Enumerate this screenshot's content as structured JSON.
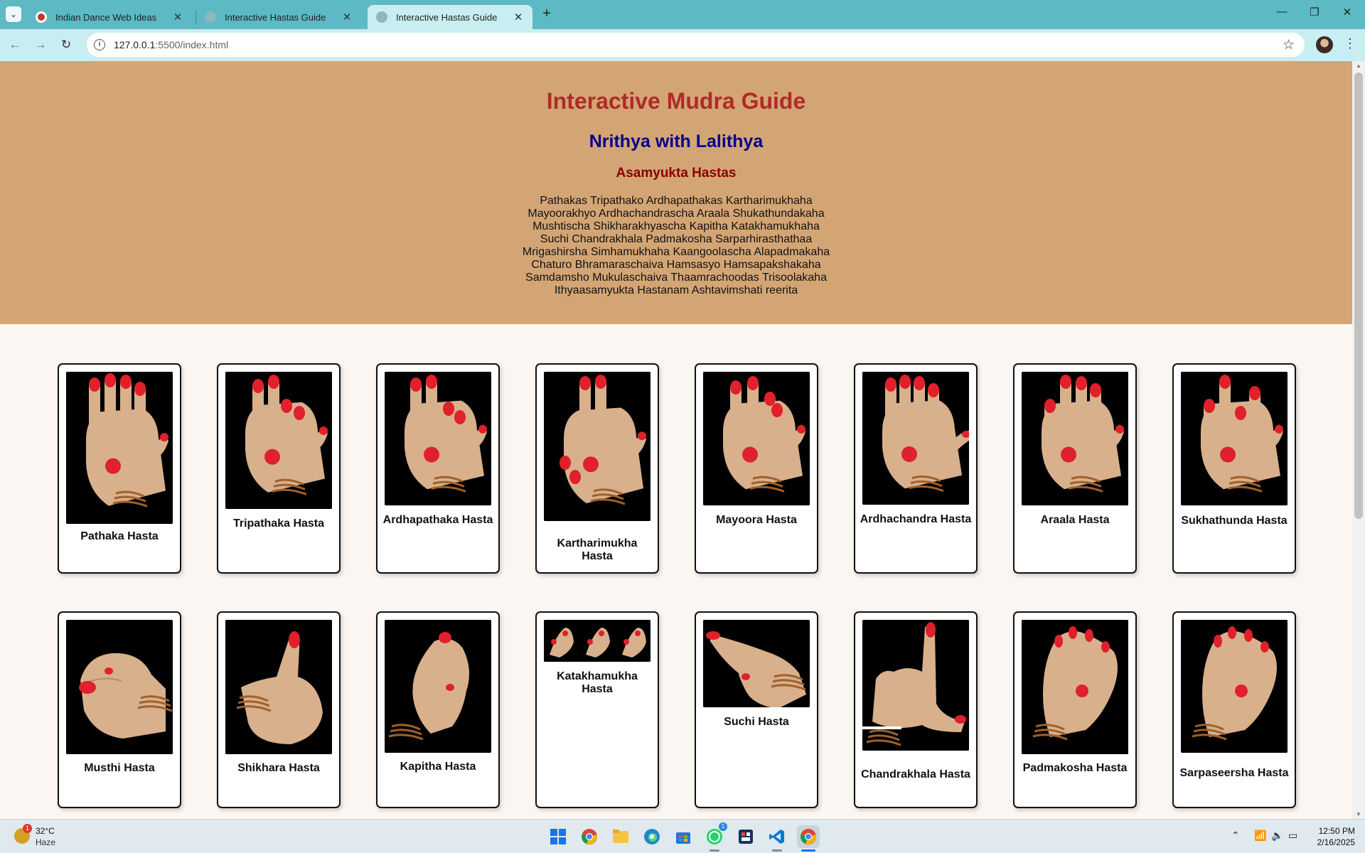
{
  "browser": {
    "tabs": [
      {
        "title": "Indian Dance Web Ideas",
        "favicon_color": "#c0392b",
        "active": false
      },
      {
        "title": "Interactive Hastas Guide",
        "favicon_color": "#8fb7bd",
        "active": false
      },
      {
        "title": "Interactive Hastas Guide",
        "favicon_color": "#8fb7bd",
        "active": true
      }
    ],
    "url_host": "127.0.0.1",
    "url_path": ":5500/index.html"
  },
  "hero": {
    "title": "Interactive Mudra Guide",
    "subtitle": "Nrithya with Lalithya",
    "section": "Asamyukta Hastas",
    "shloka": [
      "Pathakas Tripathako Ardhapathakas Kartharimukhaha",
      "Mayoorakhyo Ardhachandrascha Araala Shukathundakaha",
      "Mushtischa Shikharakhyascha Kapitha Katakhamukhaha",
      "Suchi Chandrakhala Padmakosha Sarparhirasthathaa",
      "Mrigashirsha Simhamukhaha Kaangoolascha Alapadmakaha",
      "Chaturo Bhramaraschaiva Hamsasyo Hamsapakshakaha",
      "Samdamsho Mukulaschaiva Thaamrachoodas Trisoolakaha",
      "Ithyaasamyukta Hastanam Ashtavimshati reerita"
    ],
    "colors": {
      "background": "#d4a574",
      "title": "#b02a2a",
      "subtitle": "#00008b",
      "section": "#8b0000"
    }
  },
  "cards": [
    {
      "label": "Pathaka Hasta",
      "icon": "open-palm-icon"
    },
    {
      "label": "Tripathaka Hasta",
      "icon": "hand-ring-finger-bent-icon"
    },
    {
      "label": "Ardhapathaka Hasta",
      "icon": "hand-two-fingers-bent-icon"
    },
    {
      "label": "Kartharimukha Hasta",
      "icon": "hand-scissors-icon"
    },
    {
      "label": "Mayoora Hasta",
      "icon": "hand-peacock-icon"
    },
    {
      "label": "Ardhachandra Hasta",
      "icon": "hand-thumb-extended-icon"
    },
    {
      "label": "Araala Hasta",
      "icon": "hand-index-bent-icon"
    },
    {
      "label": "Sukhathunda Hasta",
      "icon": "hand-parrot-beak-icon"
    },
    {
      "label": "Musthi Hasta",
      "icon": "fist-icon"
    },
    {
      "label": "Shikhara Hasta",
      "icon": "thumbs-up-icon"
    },
    {
      "label": "Kapitha Hasta",
      "icon": "hand-wood-apple-icon"
    },
    {
      "label": "Katakhamukha Hasta",
      "icon": "hand-sequence-icon"
    },
    {
      "label": "Suchi Hasta",
      "icon": "pointing-hand-icon"
    },
    {
      "label": "Chandrakhala Hasta",
      "icon": "hand-crescent-icon"
    },
    {
      "label": "Padmakosha Hasta",
      "icon": "hand-lotus-bud-icon"
    },
    {
      "label": "Sarpaseersha Hasta",
      "icon": "hand-snake-head-icon"
    }
  ],
  "taskbar": {
    "weather_temp": "32°C",
    "weather_desc": "Haze",
    "weather_badge": "1",
    "time": "12:50 PM",
    "date": "2/16/2025",
    "apps": [
      "start-icon",
      "chrome-icon",
      "file-explorer-icon",
      "edge-icon",
      "store-icon",
      "whatsapp-icon",
      "snipping-tool-icon",
      "vscode-icon",
      "chrome-profile-icon"
    ]
  }
}
